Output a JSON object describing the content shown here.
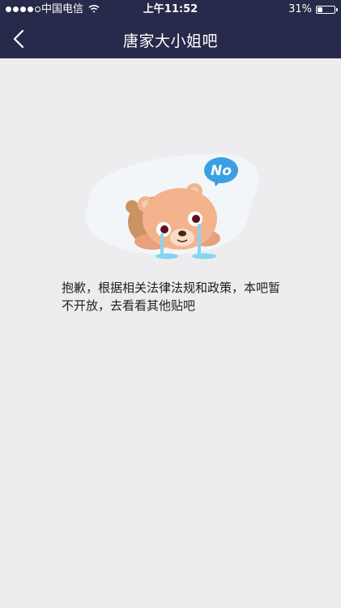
{
  "status_bar": {
    "signal_dots_filled": 4,
    "signal_dots_total": 5,
    "carrier": "中国电信",
    "time": "上午11:52",
    "battery_percent": "31%",
    "battery_level": 0.31
  },
  "nav": {
    "title": "唐家大小姐吧"
  },
  "empty_state": {
    "badge_text": "No",
    "message": "抱歉，根据相关法律法规和政策，本吧暂不开放，去看看其他贴吧"
  },
  "colors": {
    "topbar": "#272a4a",
    "background": "#ededf0",
    "badge": "#3b9fe3"
  }
}
